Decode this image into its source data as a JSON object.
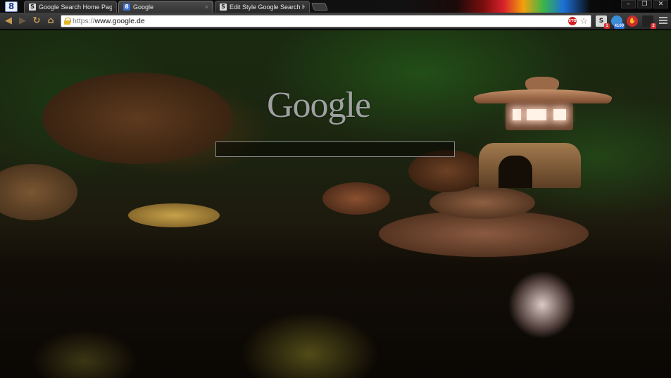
{
  "browser": {
    "app_icon": "8",
    "tabs": [
      {
        "title": "Google Search Home Pag",
        "favicon": "S",
        "active": false
      },
      {
        "title": "Google",
        "favicon": "8",
        "active": true
      },
      {
        "title": "Edit Style Google Search H",
        "favicon": "S",
        "active": false
      }
    ],
    "tab_close_glyph": "×",
    "window_controls": {
      "minimize": "–",
      "restore": "❐",
      "close": "✕"
    }
  },
  "toolbar": {
    "back_glyph": "◀",
    "forward_glyph": "▶",
    "reload_glyph": "↻",
    "home_glyph": "⌂",
    "url_scheme": "https://",
    "url_host": "www.google.de",
    "stop_label": "STOP",
    "star_glyph": "☆",
    "extensions": [
      {
        "name": "stylish-icon",
        "glyph": "S",
        "badge": "1",
        "color": "#d9d9d9"
      },
      {
        "name": "weather-icon",
        "glyph": "●",
        "badge": "4100",
        "color": "#3b8fd6"
      },
      {
        "name": "adblock-icon",
        "glyph": "✋",
        "badge": "",
        "color": "#cc2b2b"
      },
      {
        "name": "mail-icon",
        "glyph": "▬",
        "badge": "2",
        "color": "#222222"
      }
    ]
  },
  "page": {
    "logo_text": "Google",
    "search_placeholder": ""
  },
  "colors": {
    "accent_nav": "#c49a52",
    "badge_red": "#d32f2f",
    "badge_blue": "#2f6fd3"
  }
}
